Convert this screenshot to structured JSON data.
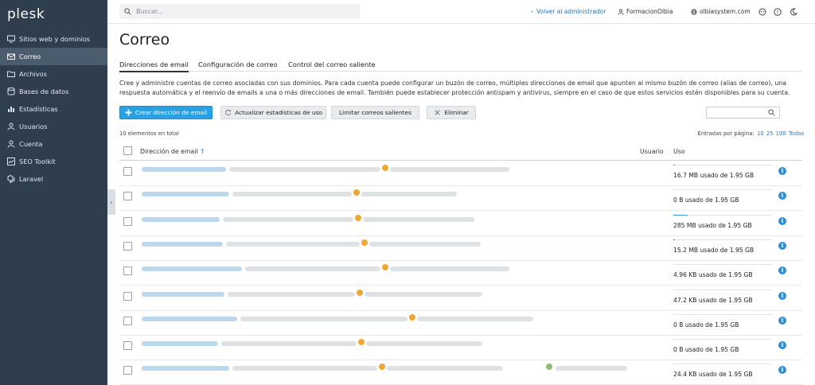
{
  "app": {
    "logo": "plesk"
  },
  "sidebar": {
    "items": [
      {
        "label": "Sitios web y dominios",
        "icon": "monitor-icon",
        "active": false
      },
      {
        "label": "Correo",
        "icon": "envelope-icon",
        "active": true
      },
      {
        "label": "Archivos",
        "icon": "folder-icon",
        "active": false
      },
      {
        "label": "Bases de datos",
        "icon": "database-icon",
        "active": false
      },
      {
        "label": "Estadísticas",
        "icon": "bar-chart-icon",
        "active": false
      },
      {
        "label": "Usuarios",
        "icon": "user-icon",
        "active": false
      },
      {
        "label": "Cuenta",
        "icon": "account-icon",
        "active": false
      },
      {
        "label": "SEO Toolkit",
        "icon": "seo-icon",
        "active": false
      },
      {
        "label": "Laravel",
        "icon": "laravel-icon",
        "active": false
      }
    ]
  },
  "topbar": {
    "search_placeholder": "Buscar...",
    "back_link": "Volver al administrador",
    "user": "FormacionOlbia",
    "domain": "olbiasystem.com"
  },
  "page": {
    "title": "Correo",
    "tabs": [
      {
        "label": "Direcciones de email",
        "active": true
      },
      {
        "label": "Configuración de correo",
        "active": false
      },
      {
        "label": "Control del correo saliente",
        "active": false
      }
    ],
    "description": "Cree y administre cuentas de correo asociadas con sus dominios. Para cada cuenta puede configurar un buzón de correo, múltiples direcciones de email que apunten al mismo buzón de correo (alias de correo), una respuesta automática y el reenvío de emails a una o más direcciones de email. También puede establecer protección antispam y antivirus, siempre en el caso de que estos servicios estén disponibles para su cuenta."
  },
  "toolbar": {
    "create": "Crear dirección de email",
    "update_stats": "Actualizar estadísticas de uso",
    "limit": "Limitar correos salientes",
    "delete": "Eliminar"
  },
  "list": {
    "count_text": "10 elementos en total",
    "per_page_label": "Entradas por página:",
    "per_page_options": [
      "10",
      "25",
      "100",
      "Todas"
    ],
    "columns": {
      "address": "Dirección de email",
      "sort_indicator": "↑",
      "user": "Usuario",
      "usage": "Uso"
    },
    "rows": [
      {
        "usage": "16.7 MB usado de 1.95 GB",
        "fill": 0.0086
      },
      {
        "usage": "0 B usado de 1.95 GB",
        "fill": 0
      },
      {
        "usage": "285 MB usado de 1.95 GB",
        "fill": 0.146
      },
      {
        "usage": "15.2 MB usado de 1.95 GB",
        "fill": 0.0078
      },
      {
        "usage": "4.96 KB usado de 1.95 GB",
        "fill": 0
      },
      {
        "usage": "47.2 KB usado de 1.95 GB",
        "fill": 0
      },
      {
        "usage": "0 B usado de 1.95 GB",
        "fill": 0
      },
      {
        "usage": "0 B usado de 1.95 GB",
        "fill": 0
      },
      {
        "usage": "24.4 KB usado de 1.95 GB",
        "fill": 0
      }
    ]
  },
  "colors": {
    "sidebar": "#2f3e4e",
    "primary_button": "#29a0e0",
    "link": "#2b77b4",
    "info": "#2d8fd5"
  }
}
